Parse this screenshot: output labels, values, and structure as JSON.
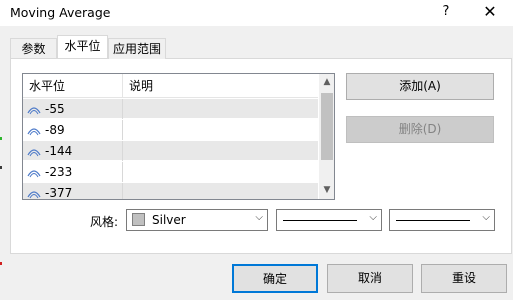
{
  "window": {
    "title": "Moving Average",
    "help_label": "?",
    "close_label": "✕"
  },
  "tabs": [
    {
      "label": "参数",
      "active": false
    },
    {
      "label": "水平位",
      "active": true
    },
    {
      "label": "应用范围",
      "active": false
    }
  ],
  "levels_table": {
    "columns": [
      "水平位",
      "说明"
    ],
    "rows": [
      {
        "value": "-55",
        "description": ""
      },
      {
        "value": "-89",
        "description": ""
      },
      {
        "value": "-144",
        "description": ""
      },
      {
        "value": "-233",
        "description": ""
      },
      {
        "value": "-377",
        "description": ""
      }
    ],
    "row_icon": "level-line-icon"
  },
  "buttons": {
    "add": "添加(A)",
    "delete": "删除(D)",
    "ok": "确定",
    "cancel": "取消",
    "reset": "重设"
  },
  "style": {
    "label": "风格:",
    "color_name": "Silver",
    "color_hex": "#c0c0c0"
  },
  "colors": {
    "accent": "#0078d7",
    "row_shade": "#e8e8e8",
    "panel_bg": "#ffffff",
    "dialog_bg": "#f0f0f0"
  }
}
